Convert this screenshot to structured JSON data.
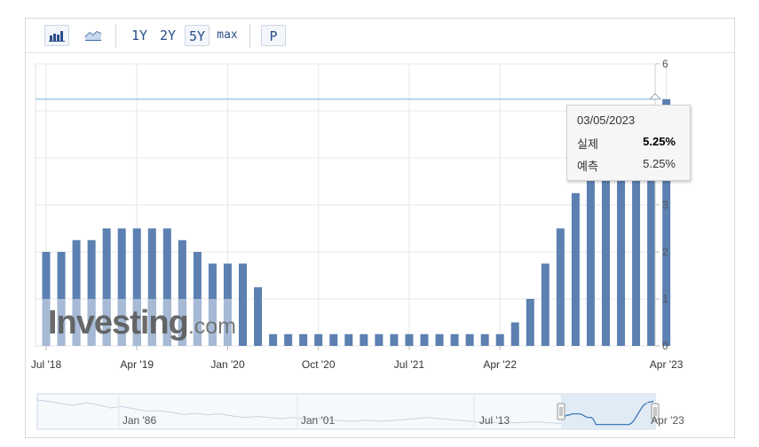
{
  "toolbar": {
    "bar_chart_icon": "bar-chart-icon",
    "line_chart_icon": "line-chart-icon",
    "ranges": [
      "1Y",
      "2Y",
      "5Y",
      "max"
    ],
    "selected_range": "5Y",
    "p_label": "P"
  },
  "tooltip": {
    "date": "03/05/2023",
    "actual_label": "실제",
    "actual_value": "5.25%",
    "forecast_label": "예측",
    "forecast_value": "5.25%"
  },
  "watermark": {
    "brand": "Investing",
    "suffix": ".com"
  },
  "navigator": {
    "labels": [
      "Jan '86",
      "Jan '01",
      "Jul '13",
      "Apr '23"
    ]
  },
  "colors": {
    "bar": "#5b80b1",
    "bar_light": "#a6bad5",
    "reference_line": "#8ec4e0",
    "grid": "#e7e7e7",
    "navigator_fill": "#dce7f3",
    "navigator_line": "#2f6fb1"
  },
  "chart_data": {
    "type": "bar",
    "y_axis_side": "right",
    "ylim": [
      0,
      6
    ],
    "yticks": [
      0,
      1,
      2,
      3,
      4,
      5,
      6
    ],
    "reference_line_value": 5.25,
    "x_tick_labels": [
      "Jul '18",
      "Apr '19",
      "Jan '20",
      "Oct '20",
      "Jul '21",
      "Apr '22",
      "Apr '23"
    ],
    "x_tick_bar_index": [
      0,
      6,
      12,
      18,
      24,
      30,
      41
    ],
    "grid": true,
    "values": [
      2.0,
      2.0,
      2.25,
      2.25,
      2.5,
      2.5,
      2.5,
      2.5,
      2.5,
      2.25,
      2.0,
      1.75,
      1.75,
      1.75,
      1.25,
      0.25,
      0.25,
      0.25,
      0.25,
      0.25,
      0.25,
      0.25,
      0.25,
      0.25,
      0.25,
      0.25,
      0.25,
      0.25,
      0.25,
      0.25,
      0.25,
      0.5,
      1.0,
      1.75,
      2.5,
      3.25,
      4.0,
      4.5,
      4.75,
      5.0,
      5.0,
      5.25
    ]
  }
}
